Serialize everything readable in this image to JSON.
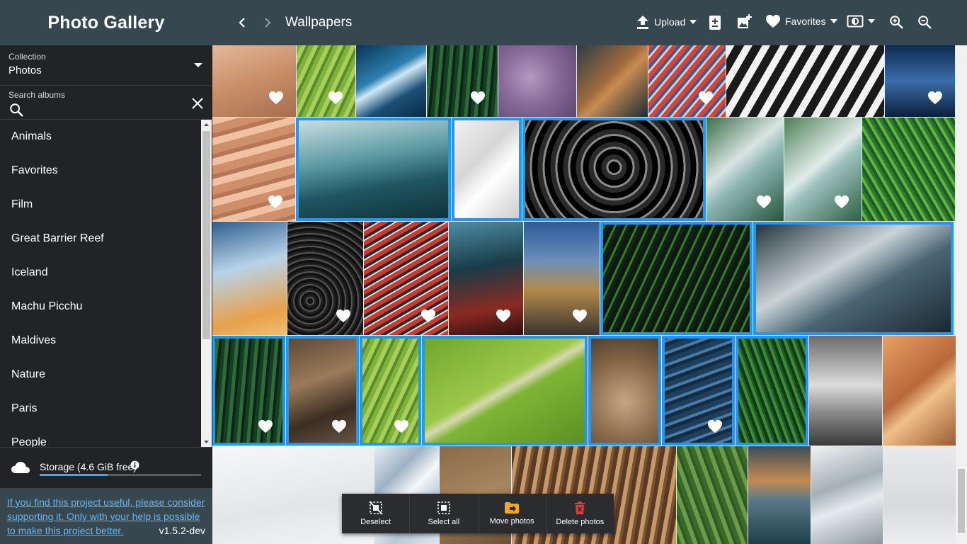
{
  "app": {
    "title": "Photo Gallery"
  },
  "sidebar": {
    "collection": {
      "label": "Collection",
      "value": "Photos"
    },
    "search": {
      "label": "Search albums",
      "value": "",
      "placeholder": ""
    },
    "albums": [
      {
        "label": "Animals"
      },
      {
        "label": "Favorites"
      },
      {
        "label": "Film"
      },
      {
        "label": "Great Barrier Reef"
      },
      {
        "label": "Iceland"
      },
      {
        "label": "Machu Picchu"
      },
      {
        "label": "Maldives"
      },
      {
        "label": "Nature"
      },
      {
        "label": "Paris"
      },
      {
        "label": "People"
      }
    ],
    "storage": {
      "label": "Storage (4.6 GiB free)",
      "used_fraction": 0.42,
      "icon": "cloud-icon"
    },
    "promo": {
      "text": "If you find this project useful, please consider supporting it. Only with your help is possible to make this project better."
    },
    "version": "v1.5.2-dev"
  },
  "topbar": {
    "title": "Wallpapers",
    "upload_label": "Upload",
    "favorites_label": "Favorites"
  },
  "colors": {
    "accent": "#2196f3",
    "header": "#37474f",
    "sidebar": "#222326"
  },
  "gallery": {
    "photos": [
      {
        "fav": true,
        "selected": false,
        "g": "linear-gradient(160deg,#e3b89a,#c98e68 50%,#a86d4d)"
      },
      {
        "fav": true,
        "selected": false,
        "g": "repeating-linear-gradient(115deg,#7db23c 0 6px,#a8cf5a 6px 12px,#5b8a2a 12px 16px)"
      },
      {
        "fav": false,
        "selected": false,
        "g": "linear-gradient(150deg,#0b3554,#2c7fb0 40%,#cfe8f5 50%,#1b4f74 70%,#0a2a45)"
      },
      {
        "fav": true,
        "selected": false,
        "g": "repeating-linear-gradient(95deg,#163e24 0 5px,#2f6a3a 5px 10px,#0c2515 10px 14px)"
      },
      {
        "fav": false,
        "selected": false,
        "g": "radial-gradient(circle at 40% 45%,#b59ac0,#8a6a9a 45%,#5d4770)"
      },
      {
        "fav": false,
        "selected": false,
        "g": "linear-gradient(135deg,#2b3d45,#a06a3b 45%,#c98b52 55%,#1c2b32)"
      },
      {
        "fav": true,
        "selected": false,
        "g": "repeating-linear-gradient(130deg,#d2453a 0 6px,#3a5a9a 6px 10px,#e8c9b5 10px 13px)"
      },
      {
        "fav": false,
        "selected": false,
        "g": "repeating-linear-gradient(120deg,#f2f2f2 0 10px,#1a1a1a 10px 22px)"
      },
      {
        "fav": true,
        "selected": false,
        "g": "linear-gradient(180deg,#0e2a4f,#3a6da8 50%,#0b1f3c)"
      },
      {
        "fav": true,
        "selected": false,
        "g": "repeating-linear-gradient(165deg,#f0c2a3 0 10px,#cf8f6a 10px 22px,#b57755 22px 28px)"
      },
      {
        "fav": false,
        "selected": true,
        "g": "linear-gradient(170deg,#cfe3e6,#5c9aa3 40%,#1f5560 65%,#0f3038)"
      },
      {
        "fav": false,
        "selected": true,
        "g": "linear-gradient(135deg,#f4f4f4,#d6d6d6 40%,#ffffff 60%,#c8c8c8)"
      },
      {
        "fav": false,
        "selected": true,
        "g": "repeating-radial-gradient(circle at 50% 48%,#000 0 8px,#8a8a8a 8px 11px,#2a2a2a 11px 18px)"
      },
      {
        "fav": true,
        "selected": false,
        "g": "linear-gradient(140deg,#3a6e4a,#d9e4e2 40%,#8fb7b5 55%,#25563e)"
      },
      {
        "fav": true,
        "selected": false,
        "g": "linear-gradient(140deg,#4d7e55,#e1ecea 45%,#9ec2be 55%,#2d5f44)"
      },
      {
        "fav": false,
        "selected": false,
        "g": "repeating-linear-gradient(60deg,#1f5b22 0 4px,#5db347 4px 8px,#2e7a2a 8px 12px)"
      },
      {
        "fav": false,
        "selected": false,
        "g": "linear-gradient(165deg,#2e5d8f,#b8d3e8 40%,#e8a04a 80%,#f0c070)"
      },
      {
        "fav": true,
        "selected": false,
        "g": "repeating-radial-gradient(circle at 30% 70%,#111 0 4px,#555 4px 6px,#222 6px 9px)"
      },
      {
        "fav": true,
        "selected": false,
        "g": "repeating-linear-gradient(150deg,#c93a30 0 6px,#2a2a35 6px 10px,#e7d8cc 10px 12px)"
      },
      {
        "fav": true,
        "selected": false,
        "g": "linear-gradient(170deg,#4d8ea6,#1a3b47 40%,#8a2a22 75%,#2b1010)"
      },
      {
        "fav": true,
        "selected": false,
        "g": "linear-gradient(180deg,#2b5a9c,#6f8fb8 35%,#b38a4a 60%,#3a3330)"
      },
      {
        "fav": false,
        "selected": true,
        "g": "repeating-linear-gradient(115deg,#0c1a0f 0 6px,#3a7a2f 6px 9px,#112315 9px 14px)"
      },
      {
        "fav": false,
        "selected": true,
        "g": "linear-gradient(150deg,#1d2d36,#c9d3d8 40%,#4a6573 60%,#17252d)"
      },
      {
        "fav": true,
        "selected": true,
        "g": "repeating-linear-gradient(95deg,#163e24 0 5px,#2f6a3a 5px 10px,#0c2515 10px 14px)"
      },
      {
        "fav": true,
        "selected": true,
        "g": "linear-gradient(160deg,#5a4633,#9a7a5a 40%,#3a2d22 70%,#6d5a45)"
      },
      {
        "fav": true,
        "selected": true,
        "g": "repeating-linear-gradient(115deg,#7db23c 0 6px,#a8cf5a 6px 12px,#5b8a2a 12px 16px)"
      },
      {
        "fav": false,
        "selected": true,
        "g": "linear-gradient(150deg,#6ea52c,#9cc84a 45%,#d6d8b0 50%,#7fb535 56%,#5a8f22)"
      },
      {
        "fav": false,
        "selected": true,
        "g": "radial-gradient(circle at 50% 60%,#c7a685,#8a6a4a 50%,#4a3a2a)"
      },
      {
        "fav": true,
        "selected": true,
        "g": "repeating-linear-gradient(160deg,#1d3f5e 0 7px,#4a7aa8 7px 11px,#142b40 11px 16px)"
      },
      {
        "fav": false,
        "selected": true,
        "g": "repeating-linear-gradient(70deg,#0f3a16 0 4px,#3f8a3a 4px 8px,#1e5a22 8px 11px)"
      },
      {
        "fav": false,
        "selected": false,
        "g": "linear-gradient(180deg,#6b6b6b,#dcdcdc 45%,#8a8a8a 70%,#3a3a3a)"
      },
      {
        "fav": false,
        "selected": false,
        "g": "linear-gradient(140deg,#e8a062,#b8683a 45%,#f0c08a 60%,#9a5a30)"
      },
      {
        "fav": false,
        "selected": false,
        "g": "linear-gradient(170deg,#f6f7f8,#e3e6e9 60%,#f2f3f4)"
      },
      {
        "fav": false,
        "selected": false,
        "g": "linear-gradient(135deg,#e8eef3,#9fb3c6 30%,#f5f7f9 50%,#b9c8d6 70%,#dfe7ee)"
      },
      {
        "fav": false,
        "selected": false,
        "g": "linear-gradient(160deg,#8a6a4a,#a6865f 50%,#6e5236)"
      },
      {
        "fav": false,
        "selected": false,
        "g": "repeating-linear-gradient(100deg,#5a3a22 0 6px,#c49a6a 6px 12px,#7a5232 12px 16px)"
      },
      {
        "fav": false,
        "selected": false,
        "g": "repeating-linear-gradient(70deg,#3a6a2a 0 6px,#6a9a4a 6px 12px,#2e5a22 12px 16px)"
      },
      {
        "fav": false,
        "selected": false,
        "g": "linear-gradient(180deg,#3d4c58,#c48a52 35%,#5a7a8a 55%,#1e3e48)"
      },
      {
        "fav": false,
        "selected": false,
        "g": "linear-gradient(160deg,#f0f2f4,#a4b0b8 40%,#e6eaed 60%,#8a979f)"
      },
      {
        "fav": false,
        "selected": false,
        "g": "linear-gradient(180deg,#e9eaec,#d7d9dc 60%,#eceef0)"
      }
    ]
  },
  "actions": [
    {
      "label": "Deselect",
      "icon": "deselect-icon"
    },
    {
      "label": "Select all",
      "icon": "select-all-icon"
    },
    {
      "label": "Move photos",
      "icon": "folder-move-icon"
    },
    {
      "label": "Delete photos",
      "icon": "trash-icon"
    }
  ]
}
